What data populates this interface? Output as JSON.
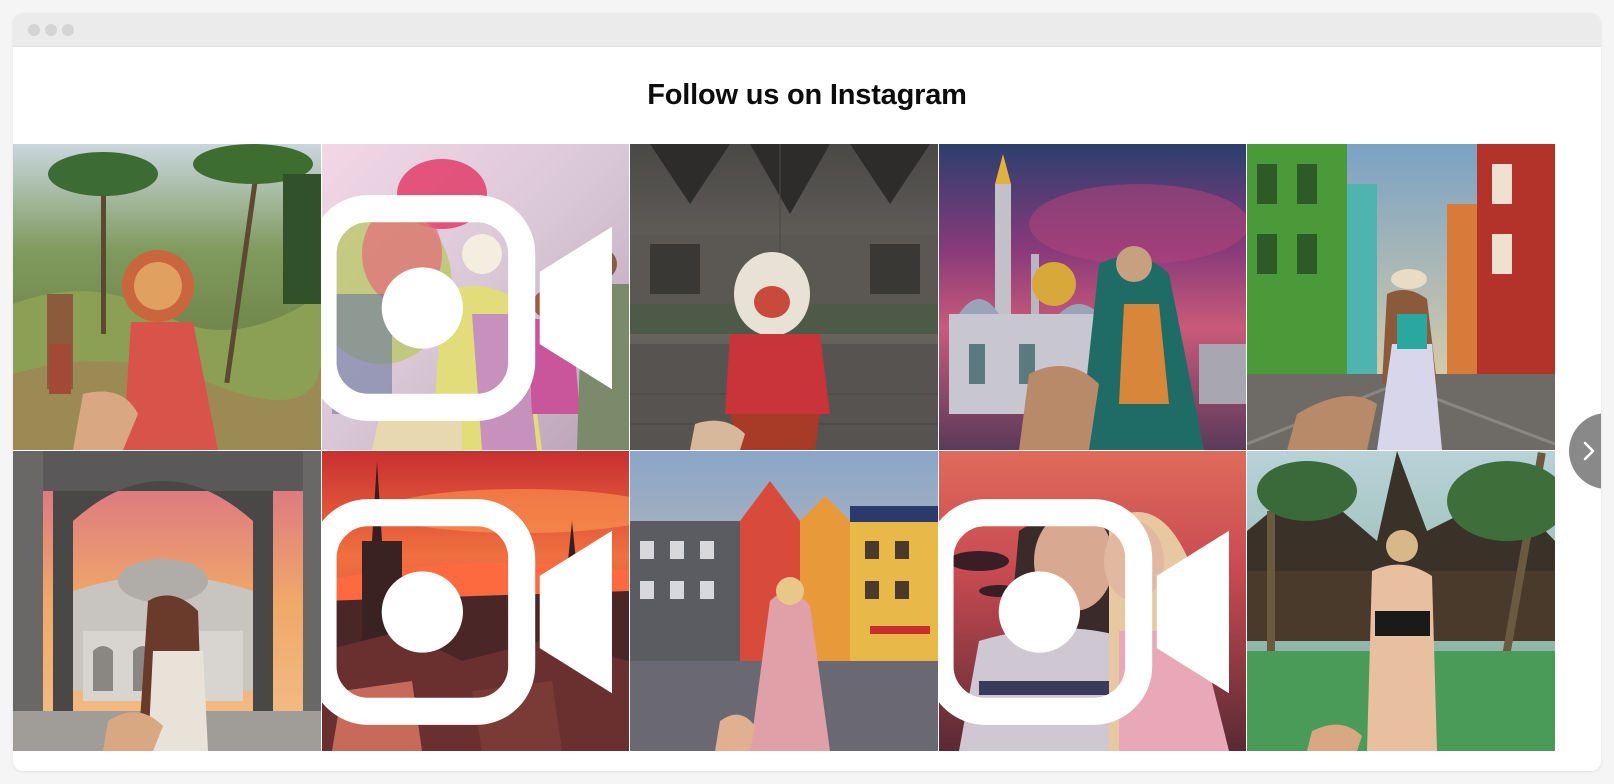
{
  "window": {
    "controls": [
      "close",
      "minimize",
      "maximize"
    ]
  },
  "heading": "Follow us on Instagram",
  "posts": [
    {
      "scene": "palm-jungle-rice-terrace",
      "is_video": false
    },
    {
      "scene": "holi-color-festival",
      "is_video": true
    },
    {
      "scene": "stone-temple-mask",
      "is_video": false
    },
    {
      "scene": "mosque-purple-sky",
      "is_video": false
    },
    {
      "scene": "colorful-houses-street",
      "is_video": false
    },
    {
      "scene": "mosque-arches-sunset",
      "is_video": false
    },
    {
      "scene": "red-sky-old-town",
      "is_video": true
    },
    {
      "scene": "colorful-square-buildings",
      "is_video": false
    },
    {
      "scene": "couple-sunset-sea",
      "is_video": true
    },
    {
      "scene": "tropical-hut-forest",
      "is_video": false
    }
  ],
  "icons": {
    "video": "video-camera-icon",
    "next": "chevron-right-icon"
  },
  "colors": {
    "background": "#f5f5f6",
    "titlebar": "#ebebec",
    "heading": "#0c0c0c"
  }
}
